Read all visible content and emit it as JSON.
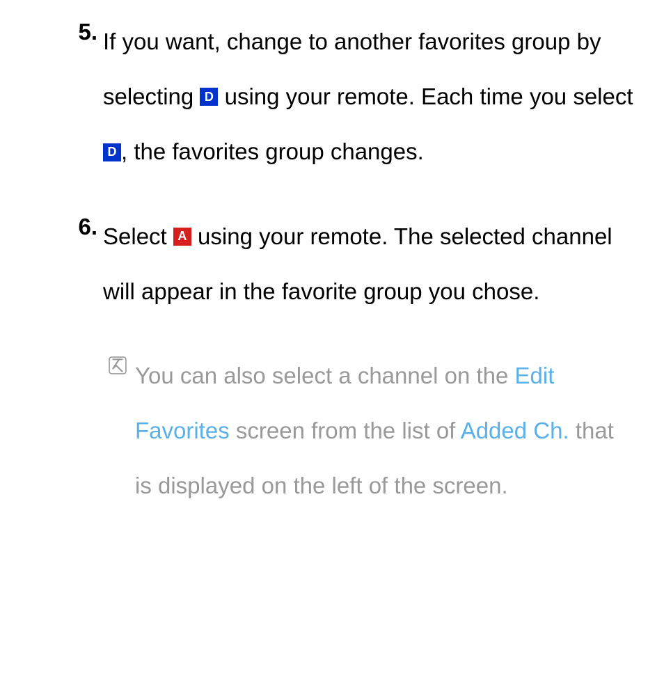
{
  "items": [
    {
      "number": "5.",
      "segments": [
        {
          "type": "text",
          "value": "If you want, change to another favorites group by selecting "
        },
        {
          "type": "badge",
          "badge": "D"
        },
        {
          "type": "text",
          "value": " using your remote. Each time you select "
        },
        {
          "type": "badge",
          "badge": "D"
        },
        {
          "type": "text",
          "value": ", the favorites group changes."
        }
      ]
    },
    {
      "number": "6.",
      "segments": [
        {
          "type": "text",
          "value": "Select "
        },
        {
          "type": "badge",
          "badge": "A"
        },
        {
          "type": "text",
          "value": " using your remote. The selected channel will appear in the favorite group you chose."
        }
      ]
    }
  ],
  "note": {
    "segments": [
      {
        "type": "text",
        "value": "You can also select a channel on the "
      },
      {
        "type": "link",
        "value": "Edit Favorites"
      },
      {
        "type": "text",
        "value": " screen from the list of "
      },
      {
        "type": "link",
        "value": "Added Ch."
      },
      {
        "type": "text",
        "value": " that is displayed on the left of the screen."
      }
    ]
  },
  "badges": {
    "D": {
      "class": "button-d",
      "label": "D"
    },
    "A": {
      "class": "button-a",
      "label": "A"
    }
  }
}
